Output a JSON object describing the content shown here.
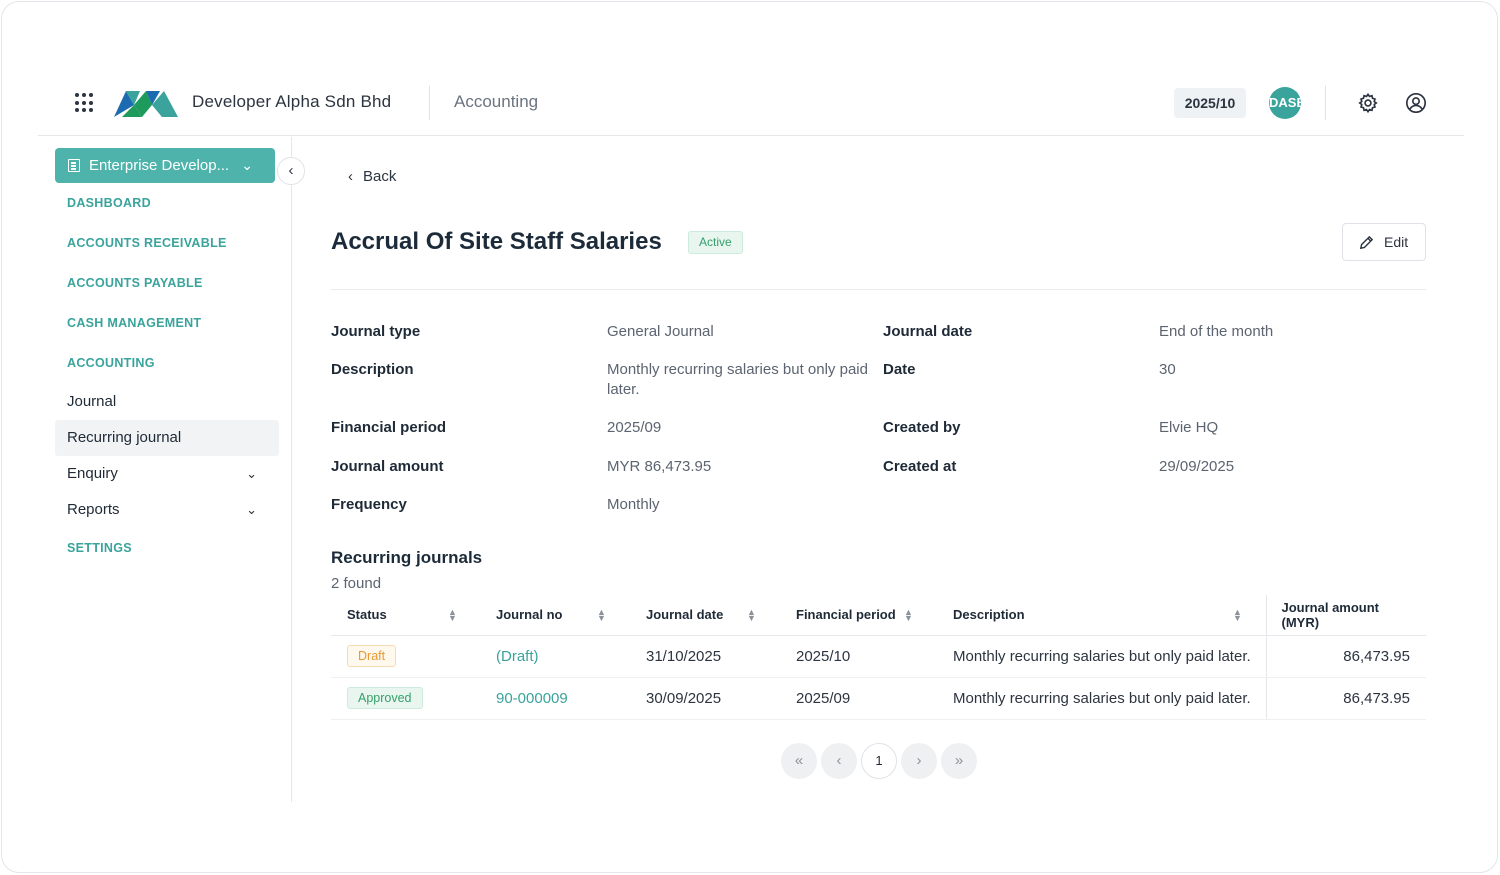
{
  "header": {
    "company": "Developer Alpha Sdn Bhd",
    "module": "Accounting",
    "period": "2025/10",
    "avatar": "DASB",
    "brand_color": "#3aa39c"
  },
  "sidebar": {
    "entity": "Enterprise Develop...",
    "sections": {
      "dashboard": "DASHBOARD",
      "ar": "ACCOUNTS RECEIVABLE",
      "ap": "ACCOUNTS PAYABLE",
      "cash": "CASH MANAGEMENT",
      "accounting": "ACCOUNTING",
      "settings": "SETTINGS"
    },
    "items": {
      "journal": "Journal",
      "recurring": "Recurring journal",
      "enquiry": "Enquiry",
      "reports": "Reports"
    }
  },
  "page": {
    "back": "Back",
    "title": "Accrual Of Site Staff Salaries",
    "status": "Active",
    "edit": "Edit"
  },
  "details": {
    "journal_type_label": "Journal type",
    "journal_type": "General Journal",
    "journal_date_label": "Journal date",
    "journal_date": "End of the month",
    "description_label": "Description",
    "description": "Monthly recurring salaries but only paid later.",
    "date_label": "Date",
    "date": "30",
    "financial_period_label": "Financial period",
    "financial_period": "2025/09",
    "created_by_label": "Created by",
    "created_by": "Elvie HQ",
    "journal_amount_label": "Journal amount",
    "journal_amount": "MYR 86,473.95",
    "created_at_label": "Created at",
    "created_at": "29/09/2025",
    "frequency_label": "Frequency",
    "frequency": "Monthly"
  },
  "recurring": {
    "title": "Recurring journals",
    "count": "2 found",
    "columns": {
      "status": "Status",
      "journal_no": "Journal no",
      "journal_date": "Journal date",
      "financial_period": "Financial period",
      "description": "Description",
      "amount": "Journal amount (MYR)"
    },
    "rows": [
      {
        "status": "Draft",
        "journal_no": "(Draft)",
        "journal_date": "31/10/2025",
        "financial_period": "2025/10",
        "description": "Monthly recurring salaries but only paid later.",
        "amount": "86,473.95"
      },
      {
        "status": "Approved",
        "journal_no": "90-000009",
        "journal_date": "30/09/2025",
        "financial_period": "2025/09",
        "description": "Monthly recurring salaries but only paid later.",
        "amount": "86,473.95"
      }
    ]
  },
  "pagination": {
    "first": "«",
    "prev": "‹",
    "current": "1",
    "next": "›",
    "last": "»"
  }
}
